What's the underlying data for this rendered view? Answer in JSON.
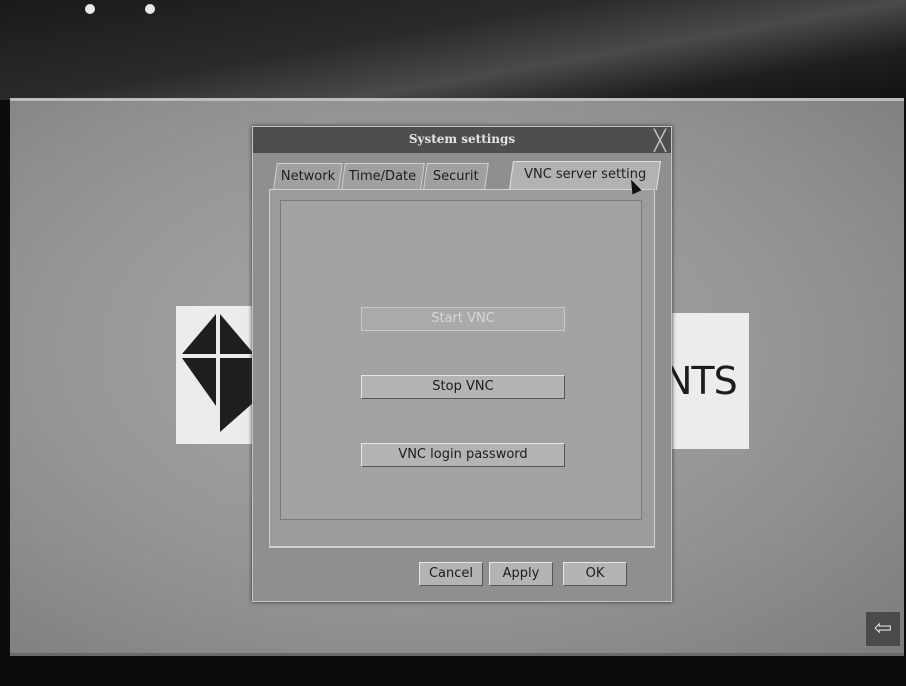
{
  "window": {
    "title": "System settings",
    "close_glyph": "╳"
  },
  "tabs": [
    {
      "label": "Network",
      "active": false
    },
    {
      "label": "Time/Date",
      "active": false
    },
    {
      "label": "Securit",
      "active": false
    },
    {
      "label": "VNC server setting",
      "active": true
    }
  ],
  "vnc_panel": {
    "start_label": "Start VNC",
    "start_enabled": false,
    "stop_label": "Stop VNC",
    "password_label": "VNC login password"
  },
  "footer": {
    "cancel_label": "Cancel",
    "apply_label": "Apply",
    "ok_label": "OK"
  },
  "background": {
    "logo_text": "NTS",
    "corner_icon": "arrow-left-icon"
  }
}
